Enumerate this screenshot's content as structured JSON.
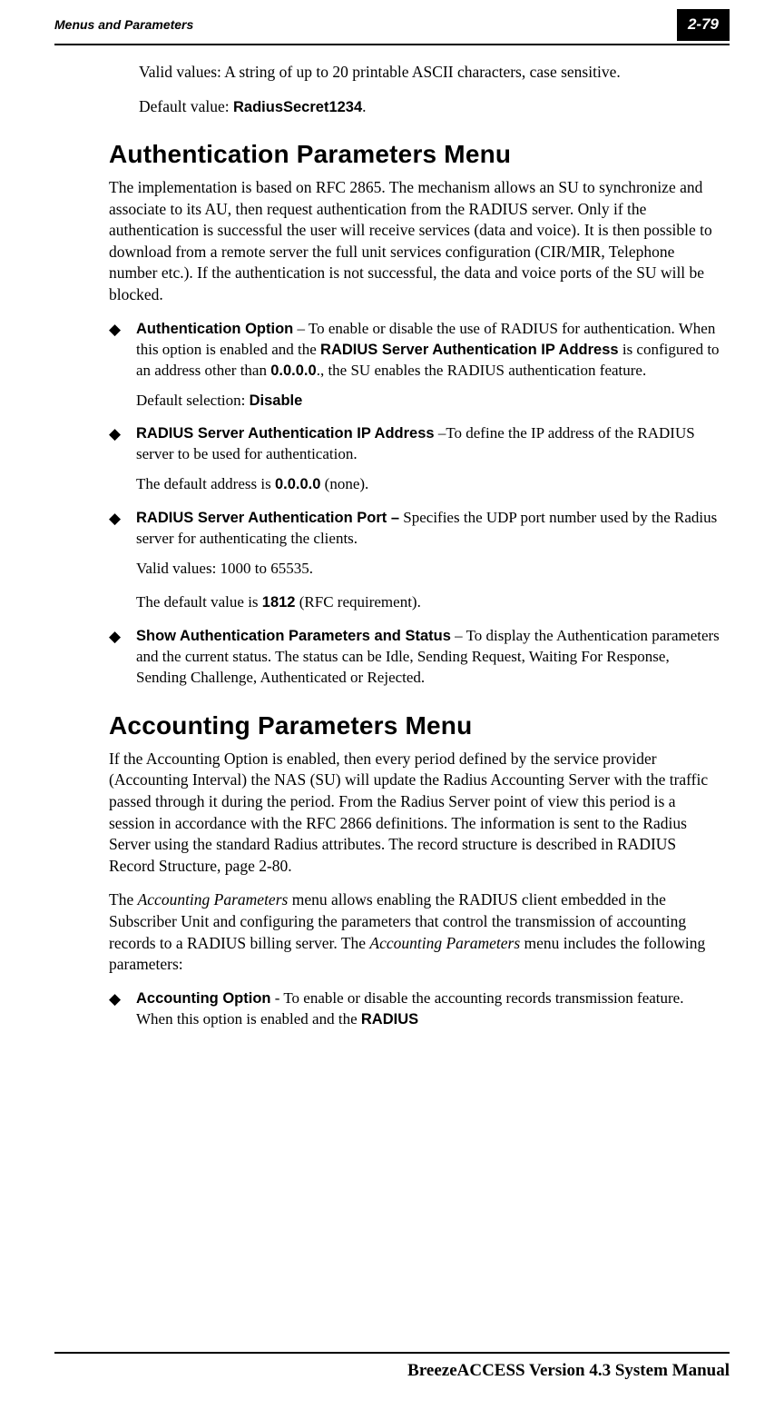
{
  "header": {
    "left": "Menus and Parameters",
    "right": "2-79"
  },
  "p1_a": "Valid values: A string of up to 20 printable ASCII characters, case sensitive.",
  "p1_b_pre": "Default value: ",
  "p1_b_bold": "RadiusSecret1234",
  "p1_b_post": ".",
  "h1": "Authentication Parameters Menu",
  "p2": "The implementation is based on RFC 2865. The mechanism allows an SU to synchronize and associate to its AU, then request authentication from the RADIUS server. Only if the authentication is successful the user will receive services (data and voice). It is then possible to download from a remote server the full unit services configuration (CIR/MIR, Telephone number etc.). If the authentication is not successful, the data and voice ports of the SU will be blocked.",
  "li1": {
    "b1": "Authentication Option",
    "t1": " – To enable or disable the use of RADIUS for authentication. When this option is enabled and the ",
    "b2": "RADIUS Server Authentication IP Address",
    "t2": " is configured to an address other than ",
    "b3": "0.0.0.0",
    "t3": "., the SU enables the RADIUS authentication feature.",
    "sub_pre": "Default selection: ",
    "sub_bold": "Disable"
  },
  "li2": {
    "b1": "RADIUS Server Authentication IP Address",
    "t1": " –To define the IP address of the RADIUS server to be used for authentication.",
    "sub_pre": "The default address is ",
    "sub_bold": "0.0.0.0",
    "sub_post": " (none)."
  },
  "li3": {
    "b1": "RADIUS Server Authentication Port –",
    "t1": " Specifies the UDP port number used by the Radius server for authenticating the clients.",
    "sub1": "Valid values: 1000 to 65535.",
    "sub2_pre": "The default value is ",
    "sub2_bold": "1812",
    "sub2_post": " (RFC requirement)."
  },
  "li4": {
    "b1": "Show Authentication Parameters and Status",
    "t1": " – To display the Authentication parameters and the current status. The status can be Idle, Sending Request, Waiting For Response, Sending Challenge, Authenticated or Rejected."
  },
  "h2": "Accounting Parameters Menu",
  "p3": "If the Accounting Option is enabled, then every period defined by the service provider (Accounting Interval) the NAS (SU) will update the Radius Accounting Server with the traffic passed through it during the period. From the Radius Server point of view this period is a session in accordance with the RFC 2866 definitions. The information is sent to the Radius Server using the standard Radius attributes. The record structure is described in RADIUS Record Structure, page 2-80.",
  "p4_pre": "The ",
  "p4_i1": "Accounting Parameters",
  "p4_mid": " menu allows enabling the RADIUS client embedded in the Subscriber Unit and configuring the parameters that control the transmission of accounting records to a RADIUS billing server. The ",
  "p4_i2": "Accounting Parameters",
  "p4_post": " menu includes the following parameters:",
  "li5": {
    "b1": "Accounting Option",
    "t1": " - To enable or disable the accounting records transmission feature. When this option is enabled and the ",
    "b2": "RADIUS"
  },
  "footer": "BreezeACCESS Version 4.3 System Manual"
}
